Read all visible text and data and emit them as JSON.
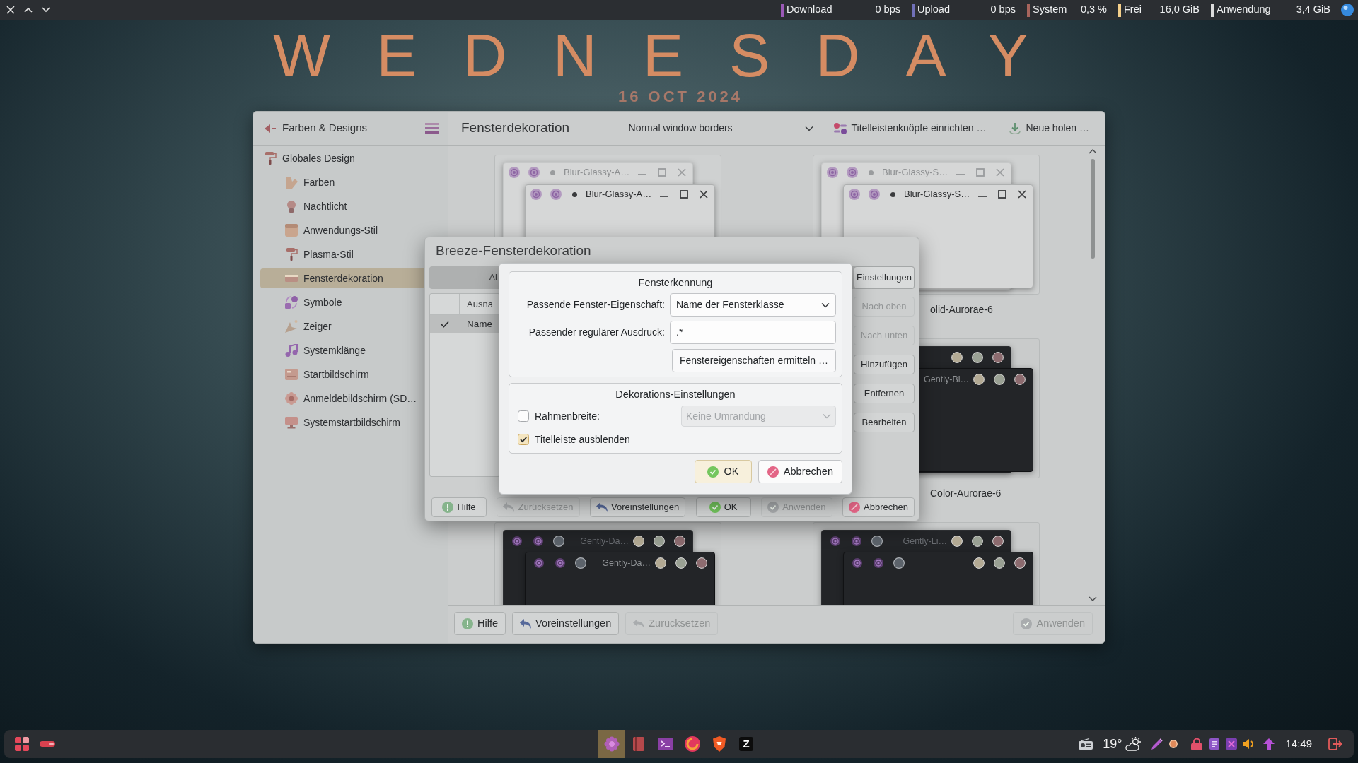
{
  "top_bar": {
    "monitors": [
      {
        "label": "Download",
        "value": "0 bps",
        "color": "#9b59b6"
      },
      {
        "label": "Upload",
        "value": "0 bps",
        "color": "#7070b8"
      },
      {
        "label": "System",
        "value": "0,3 %",
        "color": "#a8645c"
      },
      {
        "label": "Frei",
        "value": "16,0 GiB",
        "color": "#f5cf8a"
      },
      {
        "label": "Anwendung",
        "value": "3,4 GiB",
        "color": "#dcdcdc"
      }
    ]
  },
  "desktop_clock": {
    "day": "WEDNESDAY",
    "date": "16 OCT 2024"
  },
  "settings_window": {
    "sidebar": {
      "title": "Farben & Designs",
      "items": [
        {
          "label": "Globales Design",
          "selected": false,
          "children": [
            {
              "label": "Farben",
              "selected": false
            },
            {
              "label": "Nachtlicht",
              "selected": false
            },
            {
              "label": "Anwendungs-Stil",
              "selected": false
            },
            {
              "label": "Plasma-Stil",
              "selected": false
            },
            {
              "label": "Fensterdekoration",
              "selected": true
            },
            {
              "label": "Symbole",
              "selected": false
            },
            {
              "label": "Zeiger",
              "selected": false
            },
            {
              "label": "Systemklänge",
              "selected": false
            },
            {
              "label": "Startbildschirm",
              "selected": false
            },
            {
              "label": "Anmeldebildschirm (SD…",
              "selected": false
            },
            {
              "label": "Systemstartbildschirm",
              "selected": false
            }
          ]
        }
      ]
    },
    "header": {
      "title": "Fensterdekoration",
      "border_size": "Normal window borders",
      "actions": [
        "Titelleistenknöpfe einrichten …",
        "Neue holen …"
      ]
    },
    "theme_rows": [
      {
        "left": {
          "kind": "light",
          "windows": [
            {
              "title": "Blur-Glassy-A…",
              "active": false
            },
            {
              "title": "Blur-Glassy-A…",
              "active": true
            }
          ]
        },
        "right": {
          "kind": "light",
          "windows": [
            {
              "title": "Blur-Glassy-S…",
              "active": false
            },
            {
              "title": "Blur-Glassy-S…",
              "active": true
            }
          ],
          "label": "olid-Aurorae-6"
        }
      },
      {
        "right": {
          "kind": "dark",
          "windows": [
            {
              "active": false
            },
            {
              "title": "Gently-Bl…",
              "active": true
            }
          ],
          "label": "Color-Aurorae-6"
        }
      },
      {
        "left": {
          "kind": "dark",
          "windows": [
            {
              "title": "Gently-Da…",
              "active": false
            },
            {
              "title": "Gently-Da…",
              "active": true
            }
          ]
        },
        "right": {
          "kind": "dark",
          "windows": [
            {
              "title": "Gently-Li…",
              "active": false
            },
            {
              "active": true
            }
          ]
        }
      }
    ],
    "footer": {
      "left": [
        {
          "label": "Hilfe",
          "disabled": false
        },
        {
          "label": "Voreinstellungen",
          "disabled": false
        },
        {
          "label": "Zurücksetzen",
          "disabled": true
        }
      ],
      "right": [
        {
          "label": "Anwenden",
          "disabled": true
        }
      ]
    }
  },
  "breeze_dialog": {
    "title": "Breeze-Fensterdekoration",
    "tabs": [
      {
        "label": "Al",
        "selected": false
      },
      {
        "label": "Einstellungen",
        "selected": true
      }
    ],
    "table": {
      "columns": [
        "Ausna"
      ],
      "rows": [
        {
          "checked": true,
          "selected": true,
          "cells": [
            "Name"
          ]
        }
      ]
    },
    "side_buttons": [
      {
        "label": "Nach oben",
        "disabled": true
      },
      {
        "label": "Nach unten",
        "disabled": true
      },
      {
        "label": "Hinzufügen",
        "disabled": false
      },
      {
        "label": "Entfernen",
        "disabled": false
      },
      {
        "label": "Bearbeiten",
        "disabled": false
      }
    ],
    "buttons": [
      {
        "label": "Hilfe",
        "disabled": false
      },
      {
        "label": "Zurücksetzen",
        "disabled": true
      },
      {
        "label": "Voreinstellungen",
        "disabled": false
      },
      {
        "label": "OK",
        "disabled": false
      },
      {
        "label": "Anwenden",
        "disabled": true
      },
      {
        "label": "Abbrechen",
        "disabled": false
      }
    ]
  },
  "exception_dialog": {
    "identification": {
      "title": "Fensterkennung",
      "property_label": "Passende Fenster-Eigenschaft:",
      "property_value": "Name der Fensterklasse",
      "regex_label": "Passender regulärer Ausdruck:",
      "regex_value": ".*",
      "detect_button": "Fenstereigenschaften ermitteln …"
    },
    "decoration": {
      "title": "Dekorations-Einstellungen",
      "options": [
        {
          "kind": "combo",
          "label": "Rahmenbreite:",
          "checked": false,
          "value": "Keine Umrandung",
          "disabled": true
        },
        {
          "kind": "check",
          "label": "Titelleiste ausblenden",
          "checked": true
        }
      ]
    },
    "buttons": [
      {
        "label": "OK",
        "default": true
      },
      {
        "label": "Abbrechen",
        "default": false
      }
    ]
  },
  "taskbar": {
    "tasks": [
      {
        "selected": true
      },
      {
        "selected": false
      },
      {
        "selected": false
      },
      {
        "selected": false
      },
      {
        "selected": false
      },
      {
        "selected": false,
        "glyph": "Z"
      }
    ],
    "temperature": "19°",
    "clock": "14:49"
  }
}
